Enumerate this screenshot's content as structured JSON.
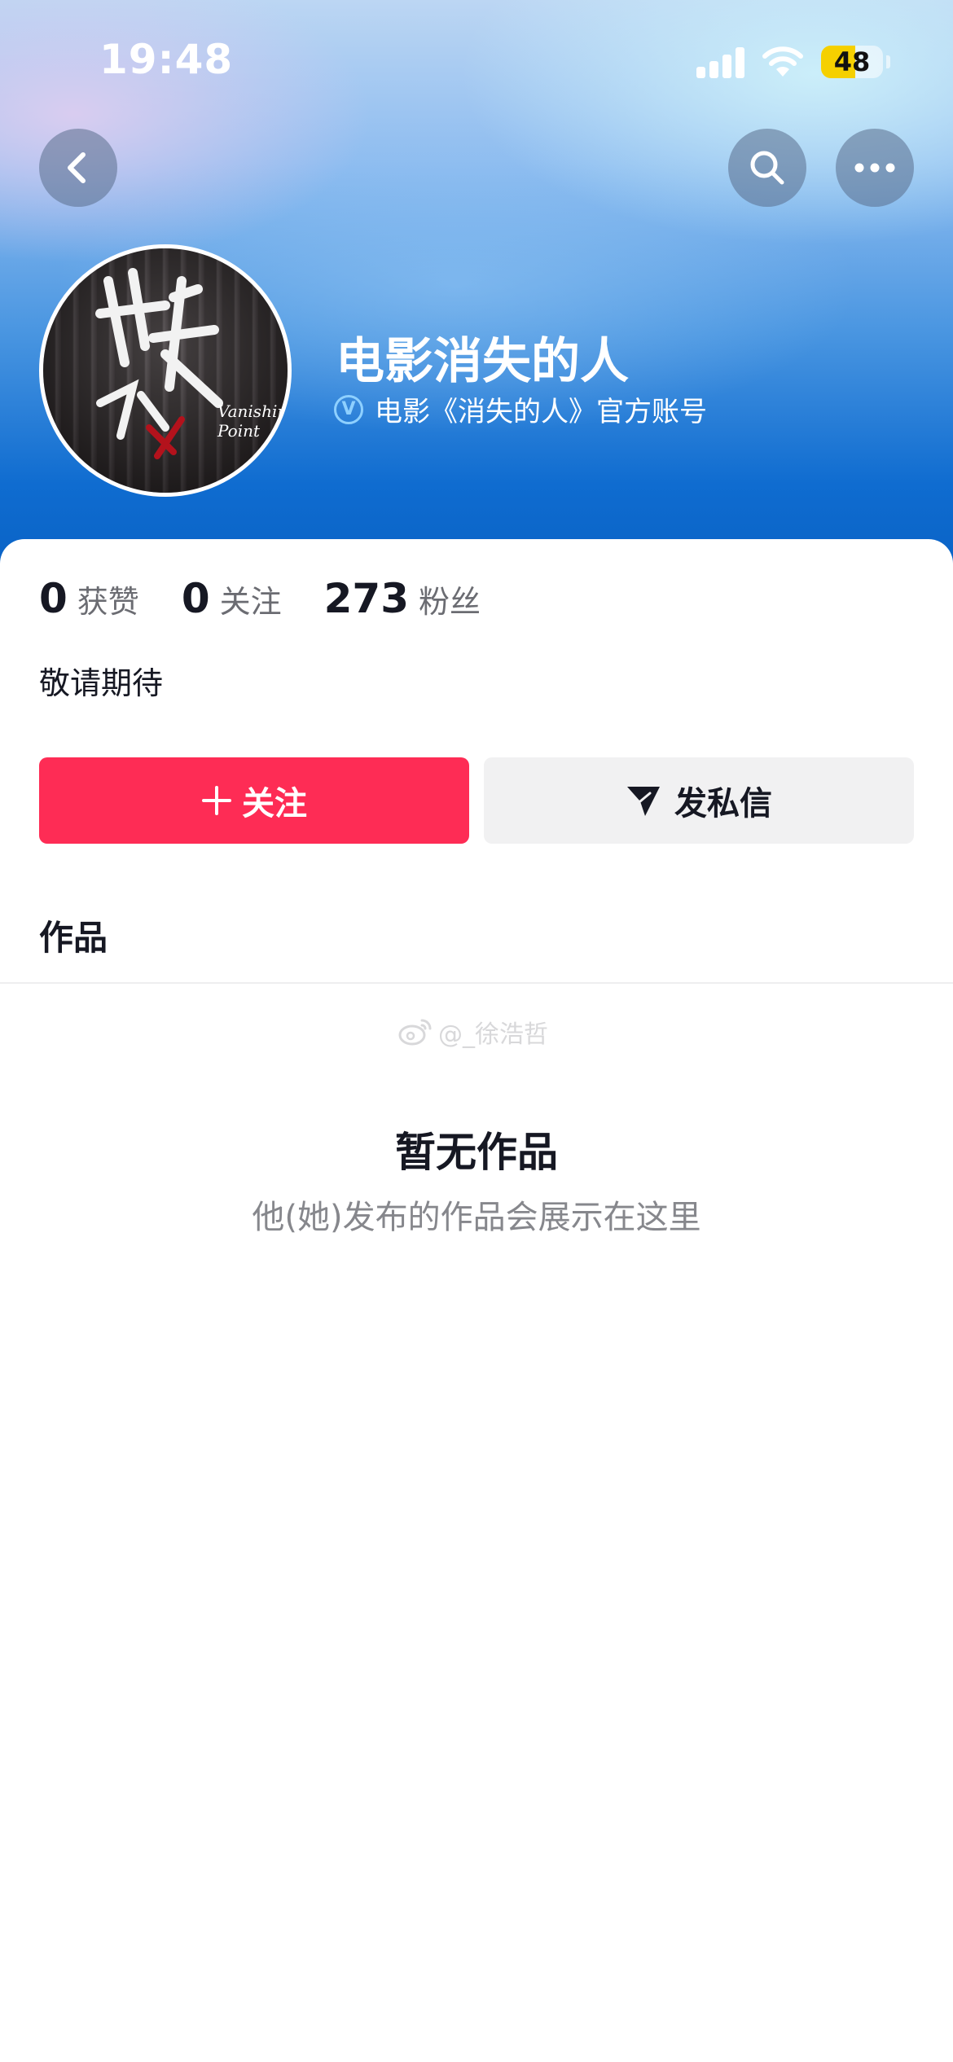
{
  "status_bar": {
    "time": "19:48",
    "battery": "48"
  },
  "profile": {
    "name": "电影消失的人",
    "verified_text": "电影《消失的人》官方账号",
    "avatar_logo": "Vanishing Point",
    "bio": "敬请期待"
  },
  "stats": [
    {
      "value": "0",
      "label": "获赞"
    },
    {
      "value": "0",
      "label": "关注"
    },
    {
      "value": "273",
      "label": "粉丝"
    }
  ],
  "actions": {
    "follow": "关注",
    "message": "发私信"
  },
  "tabs": {
    "works": "作品"
  },
  "watermark": "@_徐浩哲",
  "empty_state": {
    "title": "暂无作品",
    "subtitle": "他(她)发布的作品会展示在这里"
  },
  "colors": {
    "accent": "#fe2c55",
    "header_blue": "#0f6cd0"
  }
}
